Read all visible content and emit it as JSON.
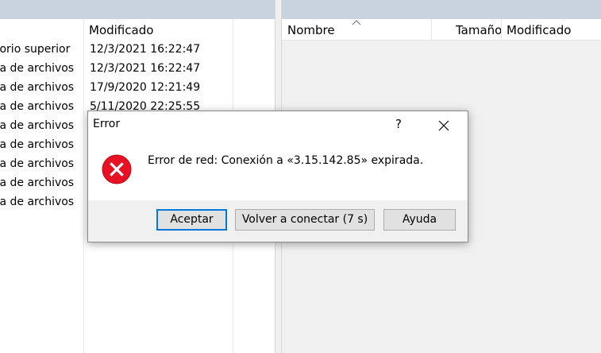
{
  "left_pane": {
    "header": {
      "modified": "Modificado"
    },
    "rows": [
      {
        "type": "torio superior",
        "modified": "12/3/2021  16:22:47"
      },
      {
        "type": "ta de archivos",
        "modified": "12/3/2021  16:22:47"
      },
      {
        "type": "ta de archivos",
        "modified": "17/9/2020  12:21:49"
      },
      {
        "type": "ta de archivos",
        "modified": "5/11/2020  22:25:55"
      },
      {
        "type": "ta de archivos",
        "modified": ""
      },
      {
        "type": "ta de archivos",
        "modified": ""
      },
      {
        "type": "ta de archivos",
        "modified": ""
      },
      {
        "type": "ta de archivos",
        "modified": ""
      },
      {
        "type": "ta de archivos",
        "modified": ""
      }
    ]
  },
  "right_pane": {
    "header": {
      "name": "Nombre",
      "size": "Tamaño",
      "modified": "Modificado",
      "sort_icon": "sort-up-icon"
    }
  },
  "dialog": {
    "title": "Error",
    "help": "?",
    "close": "✕",
    "icon": "error-icon",
    "message": "Error de red: Conexión a «3.15.142.85» expirada.",
    "buttons": {
      "ok": "Aceptar",
      "reconnect": "Volver a conectar (7 s)",
      "help": "Ayuda"
    }
  },
  "colors": {
    "topbar": "#c8d3df",
    "error_red": "#e81123",
    "default_button_border": "#0078d7"
  }
}
